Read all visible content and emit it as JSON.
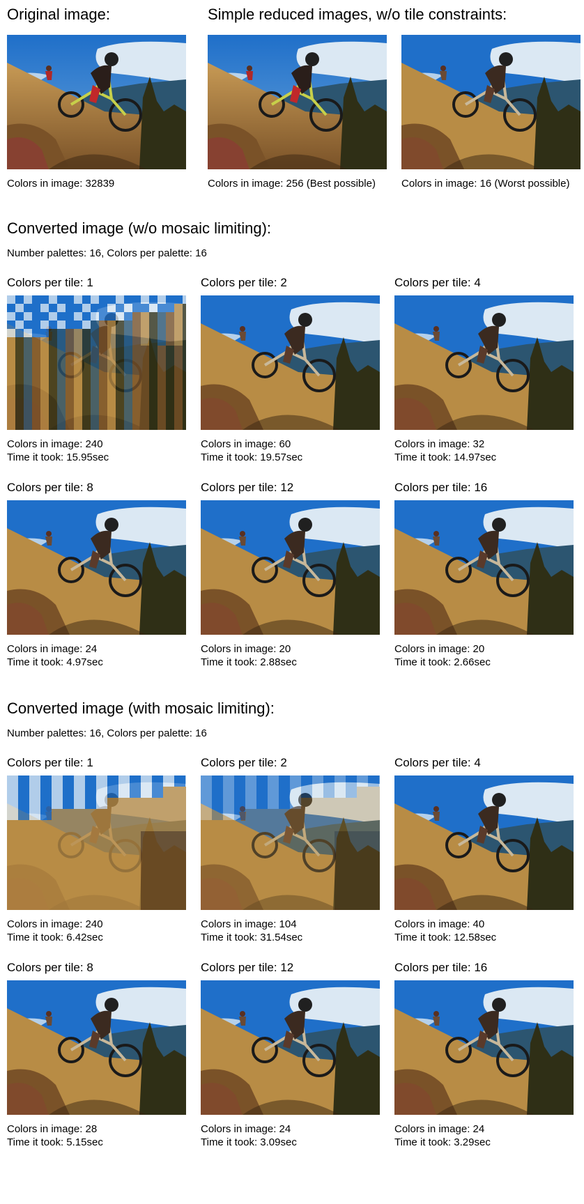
{
  "top": {
    "original_heading": "Original image:",
    "reduced_heading": "Simple reduced images, w/o tile constraints:",
    "original_caption": "Colors in image: 32839",
    "best_caption": "Colors in image: 256 (Best possible)",
    "worst_caption": "Colors in image: 16 (Worst possible)"
  },
  "section_without": {
    "heading": "Converted image (w/o mosaic limiting):",
    "subheading": "Number palettes: 16,  Colors per palette: 16",
    "tiles": [
      {
        "title": "Colors per tile: 1",
        "colors": "Colors in image: 240",
        "time": "Time it took: 15.95sec"
      },
      {
        "title": "Colors per tile: 2",
        "colors": "Colors in image: 60",
        "time": "Time it took: 19.57sec"
      },
      {
        "title": "Colors per tile: 4",
        "colors": "Colors in image: 32",
        "time": "Time it took: 14.97sec"
      },
      {
        "title": "Colors per tile: 8",
        "colors": "Colors in image: 24",
        "time": "Time it took: 4.97sec"
      },
      {
        "title": "Colors per tile: 12",
        "colors": "Colors in image: 20",
        "time": "Time it took: 2.88sec"
      },
      {
        "title": "Colors per tile: 16",
        "colors": "Colors in image: 20",
        "time": "Time it took: 2.66sec"
      }
    ]
  },
  "section_with": {
    "heading": "Converted image (with mosaic limiting):",
    "subheading": "Number palettes: 16,  Colors per palette: 16",
    "tiles": [
      {
        "title": "Colors per tile: 1",
        "colors": "Colors in image: 240",
        "time": "Time it took: 6.42sec"
      },
      {
        "title": "Colors per tile: 2",
        "colors": "Colors in image: 104",
        "time": "Time it took: 31.54sec"
      },
      {
        "title": "Colors per tile: 4",
        "colors": "Colors in image: 40",
        "time": "Time it took: 12.58sec"
      },
      {
        "title": "Colors per tile: 8",
        "colors": "Colors in image: 28",
        "time": "Time it took: 5.15sec"
      },
      {
        "title": "Colors per tile: 12",
        "colors": "Colors in image: 24",
        "time": "Time it took: 3.09sec"
      },
      {
        "title": "Colors per tile: 16",
        "colors": "Colors in image: 24",
        "time": "Time it took: 3.29sec"
      }
    ]
  },
  "colors": {
    "sky": "#1f6fc9",
    "cloud": "#dbe8f3",
    "mountain": "#2c5570",
    "grass": "#b88c45",
    "grass_dark": "#7a5228",
    "shadow": "#3a2612",
    "trees": "#2f2f16",
    "bush": "#8c3c34"
  }
}
